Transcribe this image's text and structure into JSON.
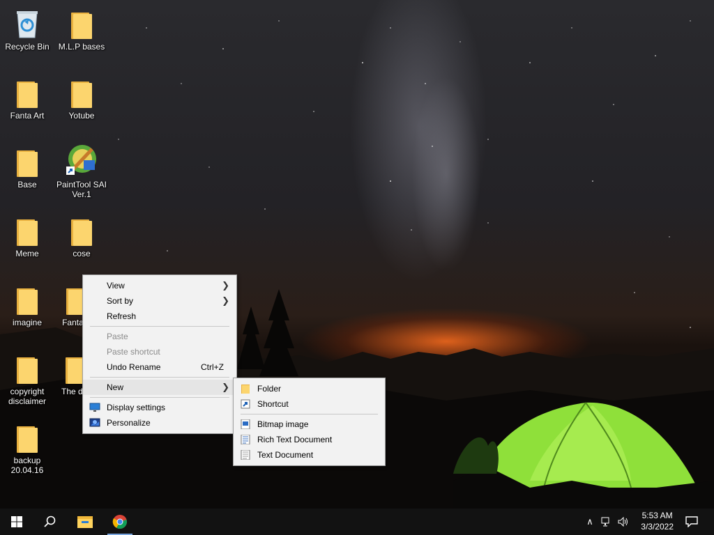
{
  "desktop": {
    "icons": [
      {
        "label": "Recycle Bin",
        "kind": "recycle-bin"
      },
      {
        "label": "M.L.P bases",
        "kind": "folder"
      },
      {
        "label": "Fanta Art",
        "kind": "folder"
      },
      {
        "label": "Yotube",
        "kind": "folder"
      },
      {
        "label": "Base",
        "kind": "folder"
      },
      {
        "label": "PaintTool SAI Ver.1",
        "kind": "app-shortcut"
      },
      {
        "label": "Meme",
        "kind": "folder"
      },
      {
        "label": "cose",
        "kind": "folder"
      },
      {
        "label": "imagine",
        "kind": "folder"
      },
      {
        "label": "Fanta Y",
        "kind": "folder"
      },
      {
        "label": "copyright disclaimer",
        "kind": "folder"
      },
      {
        "label": "The d art",
        "kind": "folder"
      },
      {
        "label": "backup 20.04.16",
        "kind": "folder"
      }
    ]
  },
  "context_menu": {
    "view": "View",
    "sort_by": "Sort by",
    "refresh": "Refresh",
    "paste": "Paste",
    "paste_shortcut": "Paste shortcut",
    "undo_rename": "Undo Rename",
    "undo_shortcut": "Ctrl+Z",
    "new": "New",
    "display_settings": "Display settings",
    "personalize": "Personalize"
  },
  "submenu_new": {
    "folder": "Folder",
    "shortcut": "Shortcut",
    "bitmap": "Bitmap image",
    "rich_text": "Rich Text Document",
    "text": "Text Document"
  },
  "taskbar": {
    "time": "5:53 AM",
    "date": "3/3/2022",
    "pinned": [
      "start-button",
      "search-button",
      "file-explorer",
      "chrome"
    ]
  },
  "colors": {
    "menu_bg": "#f2f2f2",
    "taskbar_bg": "#121212",
    "folder_yellow": "#fcd56e",
    "tent_green": "#8fe03a"
  }
}
